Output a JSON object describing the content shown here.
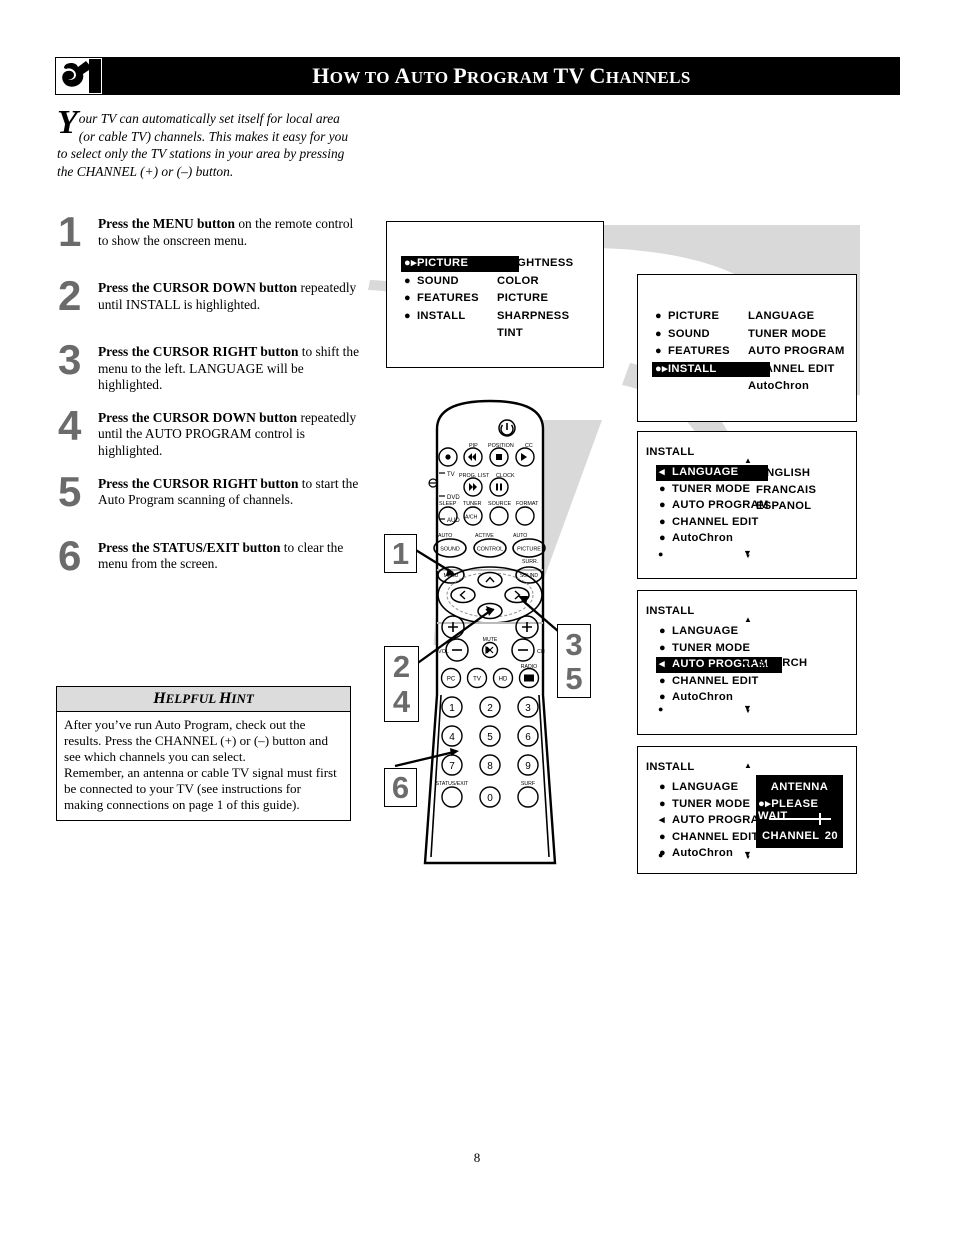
{
  "header": {
    "title_parts": [
      {
        "t": "H",
        "big": true
      },
      {
        "t": "OW",
        "big": false
      },
      {
        "t": " ",
        "big": false
      },
      {
        "t": "TO",
        "big": false
      },
      {
        "t": " ",
        "big": false
      },
      {
        "t": "A",
        "big": true
      },
      {
        "t": "UTO",
        "big": false
      },
      {
        "t": " ",
        "big": false
      },
      {
        "t": "P",
        "big": true
      },
      {
        "t": "ROGRAM",
        "big": false
      },
      {
        "t": " ",
        "big": false
      },
      {
        "t": "TV",
        "big": true
      },
      {
        "t": " ",
        "big": false
      },
      {
        "t": "C",
        "big": true
      },
      {
        "t": "HANNELS",
        "big": false
      }
    ],
    "title_plain": "How to Auto Program TV Channels",
    "logo_icon": "philips-swoosh-logo-icon"
  },
  "intro": {
    "dropcap": "Y",
    "text": "our TV can automatically set itself for local area (or cable TV) channels.  This makes it easy for you to select only the TV stations in your area by pressing the CHANNEL (+) or (–) button."
  },
  "steps": [
    {
      "num": "1",
      "bold": "Press the MENU button",
      "rest": " on the remote control to show the onscreen menu."
    },
    {
      "num": "2",
      "bold": "Press the CURSOR DOWN button",
      "rest": " repeatedly until INSTALL is highlighted."
    },
    {
      "num": "3",
      "bold": "Press the CURSOR RIGHT button",
      "rest": " to shift the menu to the left. LANGUAGE will be highlighted."
    },
    {
      "num": "4",
      "bold": "Press the CURSOR DOWN button",
      "rest": " repeatedly until the AUTO PROGRAM control is highlighted."
    },
    {
      "num": "5",
      "bold": "Press the CURSOR RIGHT button",
      "rest": " to start the Auto Program scanning of channels."
    },
    {
      "num": "6",
      "bold": "Press the STATUS/EXIT button",
      "rest": " to clear the menu from the screen."
    }
  ],
  "hint": {
    "heading_parts": [
      {
        "t": "H",
        "big": true
      },
      {
        "t": "ELPFUL",
        "big": false
      },
      {
        "t": " ",
        "big": false
      },
      {
        "t": "H",
        "big": true
      },
      {
        "t": "INT",
        "big": false
      }
    ],
    "heading_plain": "Helpful Hint",
    "para1": "After you’ve run Auto Program, check out the results.  Press the CHANNEL (+) or (–) button and see which channels you can select.",
    "para2": "Remember, an antenna or cable TV signal must first be connected to your TV (see instructions for making connections on page 1 of this guide)."
  },
  "osd_screens": [
    {
      "id": "menu-main-picture",
      "title": null,
      "left_items": [
        {
          "label": "PICTURE",
          "bullet": "●▸",
          "highlighted": true,
          "updown": true
        },
        {
          "label": "SOUND",
          "bullet": "●",
          "highlighted": false
        },
        {
          "label": "FEATURES",
          "bullet": "●",
          "highlighted": false
        },
        {
          "label": "INSTALL",
          "bullet": "●",
          "highlighted": false
        }
      ],
      "right_items": [
        "BRIGHTNESS",
        "COLOR",
        "PICTURE",
        "SHARPNESS",
        "TINT"
      ],
      "scroll_up": false,
      "scroll_down": false
    },
    {
      "id": "menu-main-install",
      "title": null,
      "left_items": [
        {
          "label": "PICTURE",
          "bullet": "●",
          "highlighted": false
        },
        {
          "label": "SOUND",
          "bullet": "●",
          "highlighted": false
        },
        {
          "label": "FEATURES",
          "bullet": "●",
          "highlighted": false
        },
        {
          "label": "INSTALL",
          "bullet": "●▸",
          "highlighted": true,
          "updown": true
        }
      ],
      "right_items": [
        "LANGUAGE",
        "TUNER MODE",
        "AUTO PROGRAM",
        "CHANNEL EDIT",
        "AutoChron"
      ],
      "scroll_up": false,
      "scroll_down": false
    },
    {
      "id": "menu-install-language",
      "title": "INSTALL",
      "left_items": [
        {
          "label": "LANGUAGE",
          "bullet": "◂",
          "highlighted": true
        },
        {
          "label": "TUNER MODE",
          "bullet": "●",
          "highlighted": false
        },
        {
          "label": "AUTO PROGRAM",
          "bullet": "●",
          "highlighted": false
        },
        {
          "label": "CHANNEL EDIT",
          "bullet": "●",
          "highlighted": false
        },
        {
          "label": "AutoChron",
          "bullet": "●",
          "highlighted": false
        }
      ],
      "right_items": [
        "ENGLISH",
        "FRANCAIS",
        "ESPANOL"
      ],
      "right_first_marker": "●▸",
      "scroll_up": true,
      "scroll_down": true
    },
    {
      "id": "menu-install-auto-program",
      "title": "INSTALL",
      "left_items": [
        {
          "label": "LANGUAGE",
          "bullet": "●",
          "highlighted": false
        },
        {
          "label": "TUNER MODE",
          "bullet": "●",
          "highlighted": false
        },
        {
          "label": "AUTO PROGRAM",
          "bullet": "◂",
          "highlighted": true
        },
        {
          "label": "CHANNEL EDIT",
          "bullet": "●",
          "highlighted": false
        },
        {
          "label": "AutoChron",
          "bullet": "●",
          "highlighted": false
        }
      ],
      "right_items": [
        "SEARCH"
      ],
      "right_first_marker": "●▸",
      "scroll_up": true,
      "scroll_down": true
    },
    {
      "id": "menu-install-searching",
      "title": "INSTALL",
      "left_items": [
        {
          "label": "LANGUAGE",
          "bullet": "●",
          "highlighted": false
        },
        {
          "label": "TUNER MODE",
          "bullet": "●",
          "highlighted": false
        },
        {
          "label": "AUTO PROGRAM",
          "bullet": "◂",
          "highlighted": false
        },
        {
          "label": "CHANNEL EDIT",
          "bullet": "●",
          "highlighted": false
        },
        {
          "label": "AutoChron",
          "bullet": "●",
          "highlighted": false
        }
      ],
      "right_items": [],
      "scroll_up": true,
      "scroll_down": true,
      "wait_panel": {
        "line1": "ANTENNA",
        "marker": "●▸",
        "line2": "PLEASE WAIT",
        "channel_label": "CHANNEL",
        "channel_value": "20"
      }
    }
  ],
  "callouts": [
    {
      "num": "1",
      "for": "menu-button"
    },
    {
      "num": "2",
      "for": "cursor-down-button"
    },
    {
      "num": "4",
      "for": "cursor-down-button"
    },
    {
      "num": "3",
      "for": "cursor-right-button"
    },
    {
      "num": "5",
      "for": "cursor-right-button"
    },
    {
      "num": "6",
      "for": "status-exit-button"
    }
  ],
  "remote": {
    "name": "tv-remote-control",
    "side_labels": [
      "TV",
      "DVD",
      "AUD"
    ],
    "row1_labels": [
      "PIP",
      "POSITION",
      "CC"
    ],
    "row2_labels": [
      "PROG. LIST",
      "CLOCK"
    ],
    "row3_labels": [
      "SLEEP",
      "TUNER",
      "SOURCE",
      "FORMAT"
    ],
    "row3_sub": [
      "A/CH"
    ],
    "row4_top": [
      "AUTO",
      "ACTIVE",
      "AUTO"
    ],
    "row4_labels": [
      "SOUND",
      "CONTROL",
      "PICTURE"
    ],
    "surr_label": "SURR.",
    "menu_label": "MENU",
    "sound_label": "SOUND",
    "vol_label": "VOL",
    "ch_label": "CH",
    "mute_label": "MUTE",
    "radio_label": "RADIO",
    "source_buttons": [
      "PC",
      "TV",
      "HD"
    ],
    "digits": [
      "1",
      "2",
      "3",
      "4",
      "5",
      "6",
      "7",
      "8",
      "9",
      "0"
    ],
    "status_exit_label": "STATUS/EXIT",
    "surf_label": "SURF"
  },
  "page_number": "8",
  "colors": {
    "header_bg": "#000000",
    "header_text": "#ffffff",
    "step_number": "#6b6b6b",
    "beam_gray": "#d6d6d6",
    "hint_header_bg": "#dcdcdc",
    "osd_highlight_bg": "#000000"
  }
}
